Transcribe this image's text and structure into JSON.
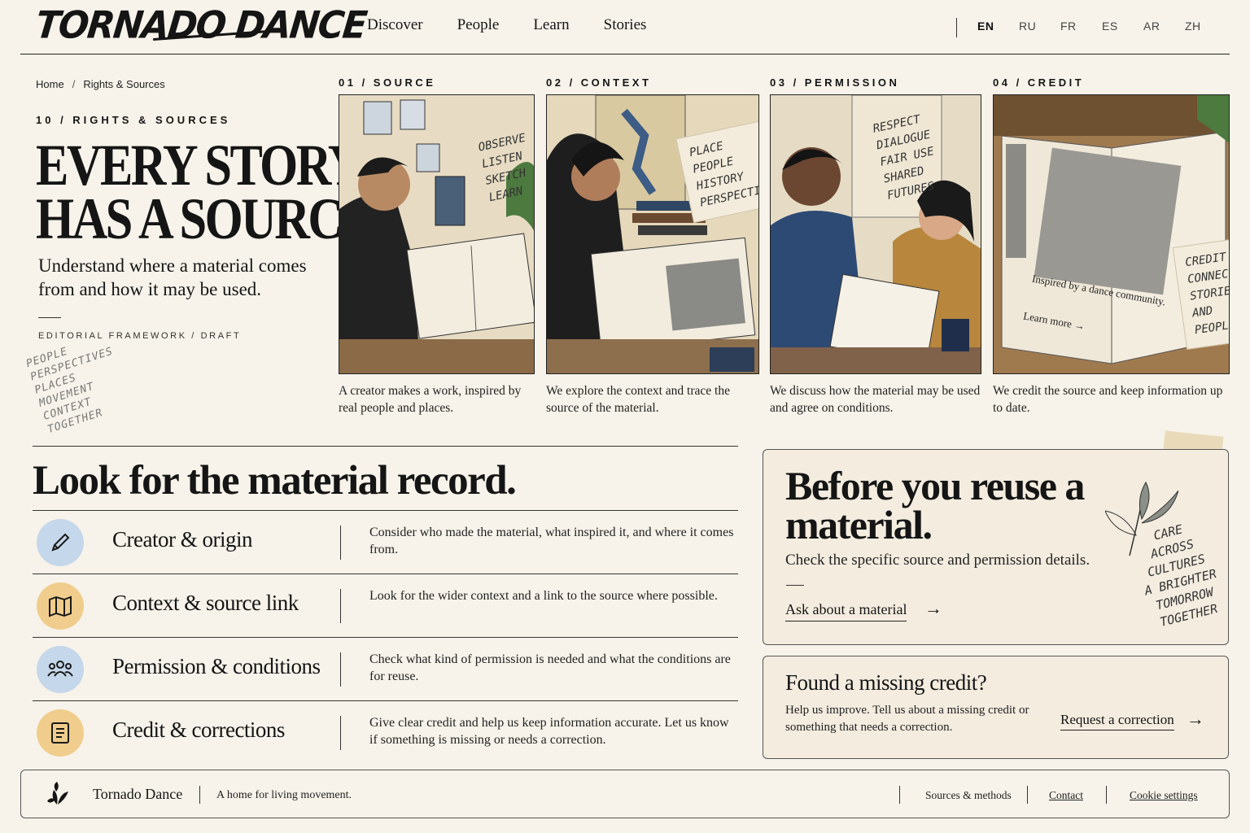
{
  "header": {
    "logo": "TORNADO DANCE",
    "nav": [
      "Discover",
      "People",
      "Learn",
      "Stories"
    ],
    "languages": [
      "EN",
      "RU",
      "FR",
      "ES",
      "AR",
      "ZH"
    ],
    "active_language": "EN"
  },
  "intro": {
    "breadcrumb": [
      "Home",
      "Rights & Sources"
    ],
    "kicker": "10 / RIGHTS & SOURCES",
    "title_line1": "EVERY STORY",
    "title_line2": "HAS A SOURCE.",
    "subtitle": "Understand where a material comes from and how it may be used.",
    "meta": "EDITORIAL FRAMEWORK / DRAFT",
    "scribble": [
      "PEOPLE",
      "PERSPECTIVES",
      "PLACES",
      "MOVEMENT",
      "CONTEXT",
      "TOGETHER"
    ]
  },
  "panels": [
    {
      "label": "01 / SOURCE",
      "caption": "A creator makes a work, inspired by real people and places.",
      "note": [
        "OBSERVE",
        "LISTEN",
        "SKETCH",
        "LEARN"
      ]
    },
    {
      "label": "02 / CONTEXT",
      "caption": "We explore the context and trace the source of the material.",
      "note": [
        "PLACE",
        "PEOPLE",
        "HISTORY",
        "PERSPECTIVE"
      ]
    },
    {
      "label": "03 / PERMISSION",
      "caption": "We discuss how the material may be used and agree on conditions.",
      "note": [
        "RESPECT",
        "DIALOGUE",
        "FAIR USE",
        "SHARED",
        "FUTURES"
      ]
    },
    {
      "label": "04 / CREDIT",
      "caption": "We credit the source and keep information up to date.",
      "note": [
        "CREDIT",
        "CONNECTS",
        "STORIES",
        "AND",
        "PEOPLE"
      ],
      "book_caption": "Inspired by a dance community.",
      "book_link": "Learn more →"
    }
  ],
  "record": {
    "title": "Look for the material record.",
    "rows": [
      {
        "icon": "pencil-icon",
        "title": "Creator & origin",
        "desc": "Consider who made the material, what inspired it, and where it comes from.",
        "color": "#c5d7ea"
      },
      {
        "icon": "map-icon",
        "title": "Context & source link",
        "desc": "Look for the wider context and a link to the source where possible.",
        "color": "#f0cd8c"
      },
      {
        "icon": "people-icon",
        "title": "Permission & conditions",
        "desc": "Check what kind of permission is needed and what the conditions are for reuse.",
        "color": "#c5d7ea"
      },
      {
        "icon": "document-icon",
        "title": "Credit & corrections",
        "desc": "Give clear credit and help us keep information accurate. Let us know if something is missing or needs a correction.",
        "color": "#f0cd8c"
      }
    ]
  },
  "reuse": {
    "title": "Before you reuse a material.",
    "text": "Check the specific source and permission details.",
    "link": "Ask about a material",
    "hand_note": [
      "CARE",
      "ACROSS",
      "CULTURES",
      "A BRIGHTER",
      "TOMORROW",
      "TOGETHER"
    ]
  },
  "missing": {
    "title": "Found a missing credit?",
    "text": "Help us improve. Tell us about a missing credit or something that needs a correction.",
    "link": "Request a correction"
  },
  "footer": {
    "brand": "Tornado Dance",
    "tagline": "A home for living movement.",
    "links": [
      "Sources & methods",
      "Contact",
      "Cookie settings"
    ]
  },
  "colors": {
    "background": "#f7f3ea",
    "card": "#f3ecdf",
    "blue_badge": "#c5d7ea",
    "amber_badge": "#f0cd8c"
  }
}
